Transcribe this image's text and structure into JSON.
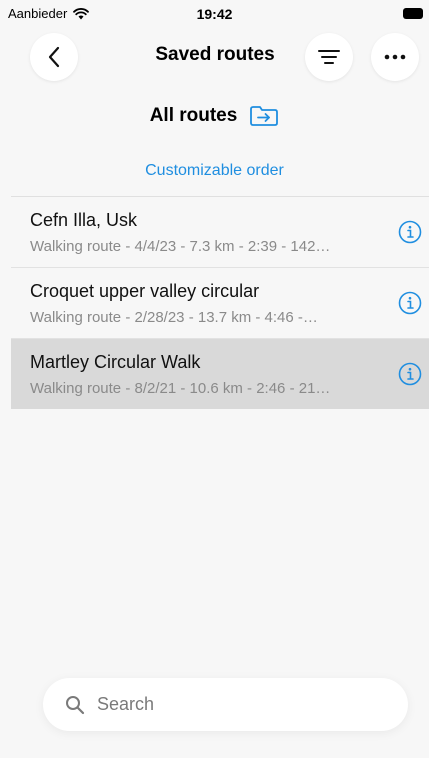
{
  "status_bar": {
    "carrier": "Aanbieder",
    "time": "19:42"
  },
  "header": {
    "title": "Saved routes"
  },
  "section": {
    "title": "All routes",
    "order_link": "Customizable order"
  },
  "routes": [
    {
      "name": "Cefn Illa, Usk",
      "meta": "Walking route - 4/4/23 - 7.3 km - 2:39 - 142…",
      "selected": false
    },
    {
      "name": "Croquet upper valley circular",
      "meta": "Walking route - 2/28/23 - 13.7 km - 4:46 -…",
      "selected": false
    },
    {
      "name": "Martley Circular Walk",
      "meta": "Walking route - 8/2/21 - 10.6 km - 2:46 - 21…",
      "selected": true
    }
  ],
  "search": {
    "placeholder": "Search",
    "value": ""
  },
  "colors": {
    "accent": "#1f8ee0",
    "selected_row": "#d9d9d9",
    "background": "#f7f7f7"
  },
  "icons": {
    "back": "chevron-left-icon",
    "filter": "filter-lines-icon",
    "more": "ellipsis-icon",
    "folder": "folder-arrow-icon",
    "info": "info-circle-icon",
    "search": "magnifier-icon",
    "wifi": "wifi-icon",
    "battery": "battery-icon"
  }
}
